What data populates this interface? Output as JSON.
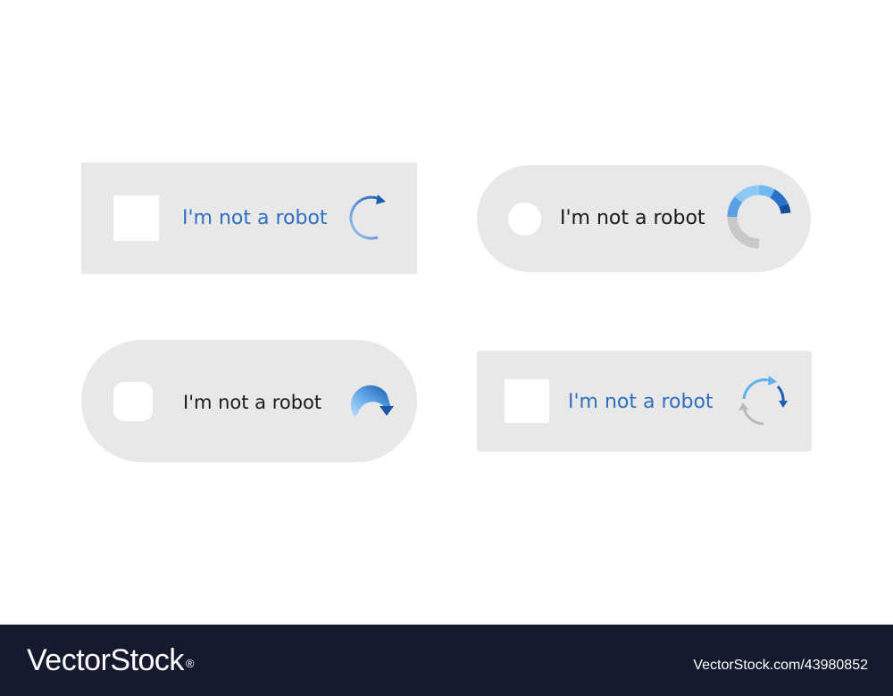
{
  "widgets": [
    {
      "label": "I'm not a robot",
      "style": "rectangle",
      "checkbox": "square",
      "spinner_icon": "refresh-arrow-icon",
      "label_color": "#2f6fc1"
    },
    {
      "label": "I'm not a robot",
      "style": "pill",
      "checkbox": "circle",
      "spinner_icon": "segmented-loading-ring-icon",
      "label_color": "#1a1a1a"
    },
    {
      "label": "I'm not a robot",
      "style": "pill",
      "checkbox": "rounded-square",
      "spinner_icon": "gradient-arrow-icon",
      "label_color": "#1a1a1a"
    },
    {
      "label": "I'm not a robot",
      "style": "rounded-rectangle",
      "checkbox": "square",
      "spinner_icon": "two-arrow-cycle-icon",
      "label_color": "#2f6fc1"
    }
  ],
  "colors": {
    "panel": "#e8e8e8",
    "accent_blue": "#2f6fc1",
    "light_blue": "#6cb4ee",
    "dark_blue": "#1d5fb5",
    "footer_bg": "#161a2e"
  },
  "footer": {
    "brand": "VectorStock",
    "brand_mark": "®",
    "image_id": "VectorStock.com/43980852"
  }
}
